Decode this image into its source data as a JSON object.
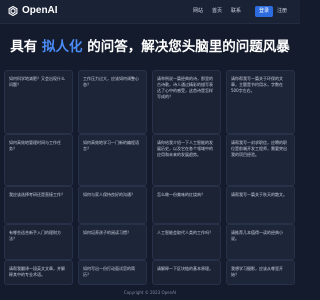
{
  "header": {
    "logo_text": "OpenAI",
    "nav": [
      "网站",
      "首页",
      "联系"
    ],
    "auth": [
      {
        "label": "登录",
        "active": true
      },
      {
        "label": "注册",
        "active": false
      }
    ]
  },
  "hero": {
    "before": "具有",
    "highlight": "拟人化",
    "after": "的问答，解决您头脑里的问题风暴"
  },
  "cards": [
    "如何科学地减肥？又会出现什么问题？",
    "工作压力过大，应该如何调整心态？",
    "请举例说一篇经典的诗，那里的古诗歌，诗人通过精彩的描写表达了心中的感受，这首诗是怎样写成的？",
    "请你帮我写一篇关于环保的文章，主题是节约用水，字数在500字左右。",
    "如何高效地管理时间与工作任务？",
    "如何高效地学习一门新的编程语言？",
    "请你给我介绍一下人工智能的发展历史，以及它在各个领域中的应用和未来的发展趋势。",
    "请帮我写一封求职信，应聘的职位是前端开发工程师，需要突出我的项目经验。",
    "我应该选择考研还是直接工作？",
    "如何与家人保持良好的沟通？",
    "怎么做一份美味的红烧肉？",
    "请帮我写一篇关于秋天的散文。",
    "有哪些适合新手入门的理财方法？",
    "如何培养孩子的阅读习惯？",
    "人工智能会取代人类的工作吗？",
    "请推荐几本值得一读的经典小说。",
    "请帮我翻译一段英文文章，并解释其中的专业术语。",
    "如何写出一份打动面试官的简历？",
    "请解释一下区块链的基本原理。",
    "我想学习摄影，应该从哪里开始？"
  ],
  "footer": "Copyright © 2023 OpenAI"
}
